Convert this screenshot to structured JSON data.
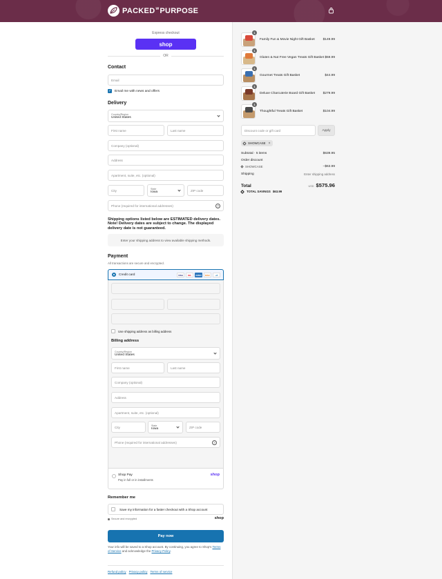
{
  "brand": {
    "name_left": "PACKED",
    "name_of": "w",
    "name_right": "PURPOSE",
    "color": "#6b2d49"
  },
  "express": {
    "label": "Express checkout",
    "shop_button": "shop",
    "or": "OR"
  },
  "contact": {
    "title": "Contact",
    "email_placeholder": "Email",
    "news_checkbox_label": "Email me with news and offers"
  },
  "delivery": {
    "title": "Delivery",
    "country_label": "Country/Region",
    "country_value": "United States",
    "first_name": "First name",
    "last_name": "Last name",
    "company": "Company (optional)",
    "address": "Address",
    "apartment": "Apartment, suite, etc. (optional)",
    "city": "City",
    "state_label": "State",
    "state_value": "Iowa",
    "zip": "ZIP code",
    "phone": "Phone (required for international addresses)",
    "shipping_note": "Shipping options listed below are ESTIMATED delivery dates. Note! Delivery dates are subject to change. The displayed delivery date is not guaranteed.",
    "shipping_placeholder": "Enter your shipping address to view available shipping methods."
  },
  "payment": {
    "title": "Payment",
    "subtitle": "All transactions are secure and encrypted.",
    "credit_card": "Credit card",
    "card_icons": [
      "VISA",
      "MC",
      "AMEX",
      "DISC",
      "+8"
    ],
    "use_shipping_label": "Use shipping address as billing address",
    "billing_title": "Billing address",
    "shop_pay_title": "Shop Pay",
    "shop_pay_sub": "Pay in full or in installments",
    "shop_pay_logo": "shop"
  },
  "remember": {
    "title": "Remember me",
    "save_label": "Save my information for a faster checkout with a Shop account",
    "secure": "Secure and encrypted",
    "shop_logo": "shop"
  },
  "pay_button": "Pay now",
  "legal": {
    "text_a": "Your info will be saved to a Shop account. By continuing, you agree to Shop's",
    "terms": "Terms of Service",
    "text_b": "and acknowledge the",
    "privacy": "Privacy Policy",
    "text_c": "."
  },
  "footer_links": [
    "Refund policy",
    "Privacy policy",
    "Terms of service"
  ],
  "cart": {
    "items": [
      {
        "name": "Family Fun & Movie Night Gift Basket",
        "price": "$149.99",
        "qty": "1",
        "color_a": "#c9a27a",
        "color_b": "#d94a3a"
      },
      {
        "name": "Gluten & Nut Free Vegan Treats Gift Basket",
        "price": "$59.99",
        "qty": "1",
        "color_a": "#d8b98a",
        "color_b": "#e07a3a"
      },
      {
        "name": "Gourmet Treats Gift Basket",
        "price": "$44.99",
        "qty": "1",
        "color_a": "#b98f62",
        "color_b": "#3a6fb0"
      },
      {
        "name": "Deluxe Charcuterie Board Gift Basket",
        "price": "$279.99",
        "qty": "1",
        "color_a": "#a7744a",
        "color_b": "#7a3a2a"
      },
      {
        "name": "Thoughtful Treats Gift Basket",
        "price": "$104.99",
        "qty": "1",
        "color_a": "#c49a6c",
        "color_b": "#4a4a4a"
      }
    ],
    "discount_placeholder": "Discount code or gift card",
    "apply": "Apply",
    "applied_code": "SHOWCASE",
    "subtotal_label": "Subtotal · 5 items",
    "subtotal_value": "$639.95",
    "order_discount_label": "Order discount",
    "discount_code": "SHOWCASE",
    "discount_value": "−$63.99",
    "shipping_label": "Shipping",
    "shipping_value": "Enter shipping address",
    "total_label": "Total",
    "currency": "USD",
    "total_value": "$575.96",
    "savings_label": "TOTAL SAVINGS",
    "savings_value": "$63.99"
  }
}
